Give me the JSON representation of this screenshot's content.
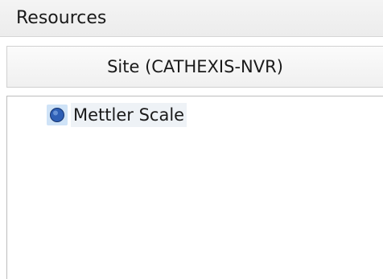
{
  "panel": {
    "title": "Resources"
  },
  "site_bar": {
    "label": "Site (CATHEXIS-NVR)"
  },
  "tree": {
    "items": [
      {
        "label": "Mettler Scale",
        "icon": "device-icon",
        "color": "#2e5fb5"
      }
    ]
  }
}
